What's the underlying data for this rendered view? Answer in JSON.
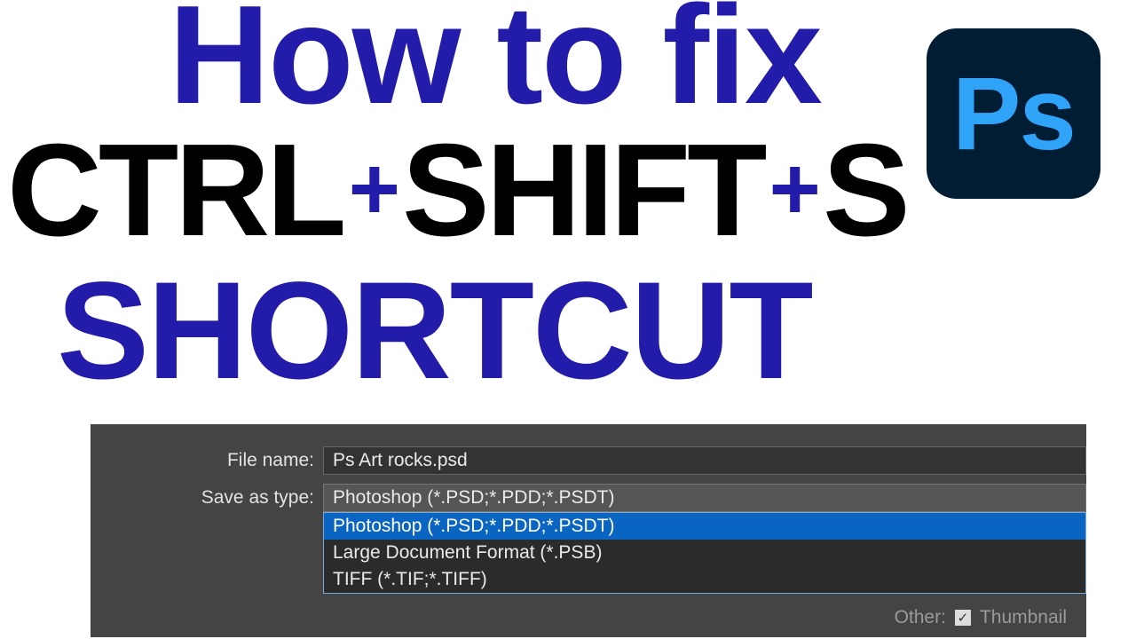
{
  "title": {
    "line1": "How to fix",
    "kbd_ctrl": "CTRL",
    "plus": "+",
    "kbd_shift": "SHIFT",
    "kbd_s": "S",
    "line3": "SHORTCUT"
  },
  "app_icon": {
    "text": "Ps"
  },
  "dialog": {
    "filename_label": "File name:",
    "filename_value": "Ps Art rocks.psd",
    "savetype_label": "Save as type:",
    "savetype_value": "Photoshop (*.PSD;*.PDD;*.PSDT)",
    "options": [
      "Photoshop (*.PSD;*.PDD;*.PSDT)",
      "Large Document Format (*.PSB)",
      "TIFF (*.TIF;*.TIFF)"
    ],
    "other_label": "Other:",
    "thumbnail_label": "Thumbnail"
  }
}
